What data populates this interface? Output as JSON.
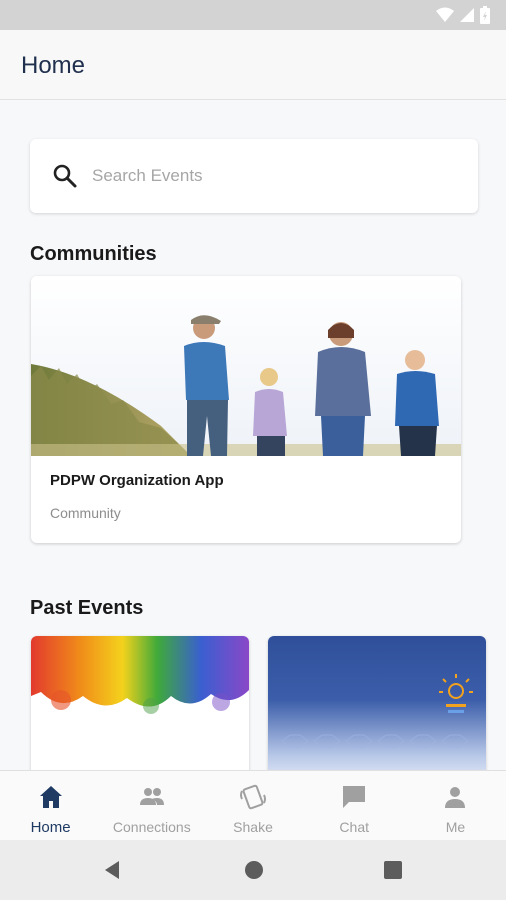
{
  "app": {
    "title": "Home"
  },
  "search": {
    "placeholder": "Search Events"
  },
  "sections": {
    "communities": "Communities",
    "past_events": "Past Events"
  },
  "community_card": {
    "name": "PDPW Organization App",
    "type": "Community"
  },
  "bottom_nav": {
    "items": [
      {
        "label": "Home",
        "icon": "home-icon",
        "active": true
      },
      {
        "label": "Connections",
        "icon": "people-icon",
        "active": false
      },
      {
        "label": "Shake",
        "icon": "shake-icon",
        "active": false
      },
      {
        "label": "Chat",
        "icon": "chat-icon",
        "active": false
      },
      {
        "label": "Me",
        "icon": "person-icon",
        "active": false
      }
    ]
  },
  "colors": {
    "accent": "#1f3b64",
    "inactive": "#a0a0a0"
  }
}
